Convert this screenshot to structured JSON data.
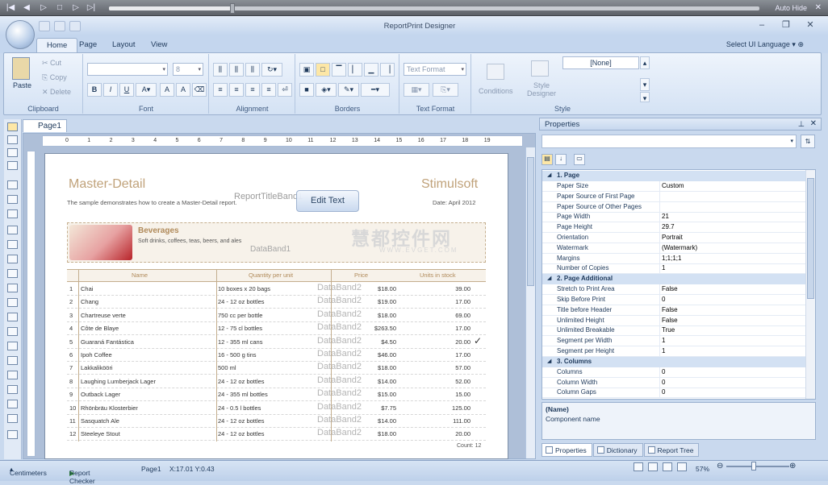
{
  "player": {
    "auto_hide": "Auto Hide",
    "progress_fraction": 0.19
  },
  "app": {
    "title": "ReportPrint Designer"
  },
  "ribbon": {
    "tabs": [
      "Home",
      "Page",
      "Layout",
      "View"
    ],
    "select_ui_language": "Select UI Language",
    "clipboard": {
      "paste": "Paste",
      "cut": "Cut",
      "copy": "Copy",
      "delete": "Delete",
      "label": "Clipboard"
    },
    "font": {
      "size": "8",
      "label": "Font",
      "bold": "B",
      "italic": "I",
      "underline": "U"
    },
    "alignment": {
      "label": "Alignment"
    },
    "borders": {
      "label": "Borders"
    },
    "text_format": {
      "combo": "Text Format",
      "label": "Text Format"
    },
    "style": {
      "conditions": "Conditions",
      "style_designer": "Style Designer",
      "style_value": "[None]",
      "label": "Style"
    }
  },
  "page_tab": "Page1",
  "ruler": [
    "0",
    "1",
    "2",
    "3",
    "4",
    "5",
    "6",
    "7",
    "8",
    "9",
    "10",
    "11",
    "12",
    "13",
    "14",
    "15",
    "16",
    "17",
    "18",
    "19"
  ],
  "report": {
    "title": "Master-Detail",
    "brand": "Stimulsoft",
    "band_label": "ReportTitleBand1",
    "description": "The sample demonstrates how to create a Master-Detail report.",
    "date": "Date: April 2012",
    "edit_text": "Edit Text",
    "watermark": "慧都控件网",
    "watermark_url": "WWW.EVGET.COM",
    "category_name": "Beverages",
    "category_desc": "Soft drinks, coffees, teas, beers, and ales",
    "databand1": "DataBand1",
    "databand2": "DataBand2",
    "headers": [
      "Name",
      "Quantity per unit",
      "Price",
      "Units in stock"
    ],
    "rows": [
      {
        "n": "1",
        "name": "Chai",
        "qty": "10 boxes x 20 bags",
        "price": "$18.00",
        "stock": "39.00"
      },
      {
        "n": "2",
        "name": "Chang",
        "qty": "24 - 12 oz bottles",
        "price": "$19.00",
        "stock": "17.00"
      },
      {
        "n": "3",
        "name": "Chartreuse verte",
        "qty": "750 cc per bottle",
        "price": "$18.00",
        "stock": "69.00"
      },
      {
        "n": "4",
        "name": "Côte de Blaye",
        "qty": "12 - 75 cl bottles",
        "price": "$263.50",
        "stock": "17.00"
      },
      {
        "n": "5",
        "name": "Guaraná Fantástica",
        "qty": "12 - 355 ml cans",
        "price": "$4.50",
        "stock": "20.00"
      },
      {
        "n": "6",
        "name": "Ipoh Coffee",
        "qty": "16 - 500 g tins",
        "price": "$46.00",
        "stock": "17.00"
      },
      {
        "n": "7",
        "name": "Lakkalikööri",
        "qty": "500 ml",
        "price": "$18.00",
        "stock": "57.00"
      },
      {
        "n": "8",
        "name": "Laughing Lumberjack Lager",
        "qty": "24 - 12 oz bottles",
        "price": "$14.00",
        "stock": "52.00"
      },
      {
        "n": "9",
        "name": "Outback Lager",
        "qty": "24 - 355 ml bottles",
        "price": "$15.00",
        "stock": "15.00"
      },
      {
        "n": "10",
        "name": "Rhönbräu Klosterbier",
        "qty": "24 - 0.5 l bottles",
        "price": "$7.75",
        "stock": "125.00"
      },
      {
        "n": "11",
        "name": "Sasquatch Ale",
        "qty": "24 - 12 oz bottles",
        "price": "$14.00",
        "stock": "111.00"
      },
      {
        "n": "12",
        "name": "Steeleye Stout",
        "qty": "24 - 12 oz bottles",
        "price": "$18.00",
        "stock": "20.00"
      }
    ],
    "count": "Count: 12"
  },
  "properties": {
    "title": "Properties",
    "categories": [
      {
        "name": "1. Page",
        "items": [
          [
            "Paper Size",
            "Custom"
          ],
          [
            "Paper Source of First Page",
            ""
          ],
          [
            "Paper Source of Other Pages",
            ""
          ],
          [
            "Page Width",
            "21"
          ],
          [
            "Page Height",
            "29.7"
          ],
          [
            "Orientation",
            "Portrait"
          ],
          [
            "Watermark",
            "(Watermark)"
          ],
          [
            "Margins",
            "1;1;1;1"
          ],
          [
            "Number of Copies",
            "1"
          ]
        ]
      },
      {
        "name": "2. Page  Additional",
        "items": [
          [
            "Stretch to Print Area",
            "False"
          ],
          [
            "Skip Before Print",
            "0"
          ],
          [
            "Title before Header",
            "False"
          ],
          [
            "Unlimited Height",
            "False"
          ],
          [
            "Unlimited Breakable",
            "True"
          ],
          [
            "Segment per Width",
            "1"
          ],
          [
            "Segment per Height",
            "1"
          ]
        ]
      },
      {
        "name": "3. Columns",
        "items": [
          [
            "Columns",
            "0"
          ],
          [
            "Column Width",
            "0"
          ],
          [
            "Column Gaps",
            "0"
          ]
        ]
      }
    ],
    "desc_name": "(Name)",
    "desc_text": "Component name",
    "tabs": [
      "Properties",
      "Dictionary",
      "Report Tree"
    ]
  },
  "status": {
    "units": "Centimeters",
    "checker": "Report Checker",
    "page": "Page1",
    "coords": "X:17.01  Y:0.43",
    "zoom": "57%"
  }
}
